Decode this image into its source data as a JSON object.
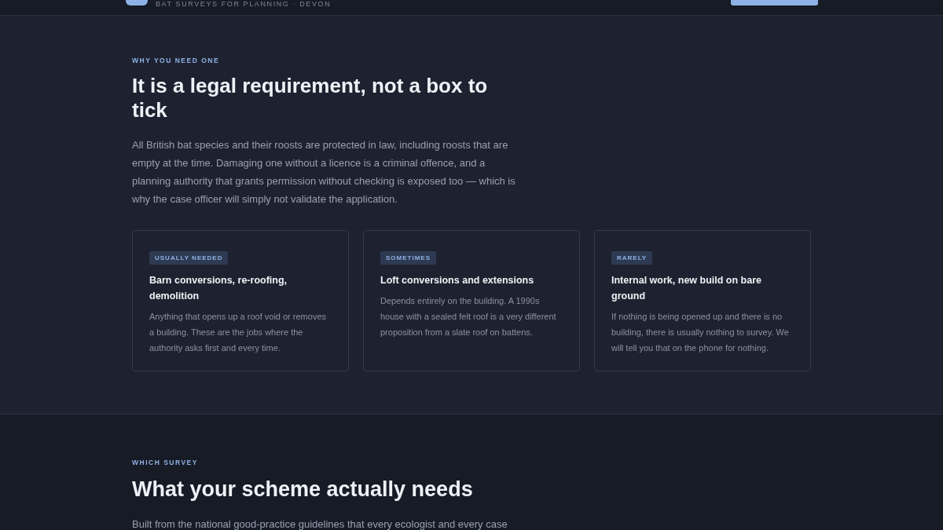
{
  "header": {
    "tagline": "BAT SURVEYS FOR PLANNING · DEVON"
  },
  "sections": [
    {
      "eyebrow": "WHY YOU NEED ONE",
      "heading": "It is a legal requirement, not a box to tick",
      "intro": "All British bat species and their roosts are protected in law, including roosts that are empty at the time. Damaging one without a licence is a criminal offence, and a planning authority that grants permission without checking is exposed too — which is why the case officer will simply not validate the application.",
      "cards": [
        {
          "tag": "USUALLY NEEDED",
          "title": "Barn conversions, re-roofing, demolition",
          "body": "Anything that opens up a roof void or removes a building. These are the jobs where the authority asks first and every time."
        },
        {
          "tag": "SOMETIMES",
          "title": "Loft conversions and extensions",
          "body": "Depends entirely on the building. A 1990s house with a sealed felt roof is a very different proposition from a slate roof on battens."
        },
        {
          "tag": "RARELY",
          "title": "Internal work, new build on bare ground",
          "body": "If nothing is being opened up and there is no building, there is usually nothing to survey. We will tell you that on the phone for nothing."
        }
      ]
    },
    {
      "eyebrow": "WHICH SURVEY",
      "heading": "What your scheme actually needs",
      "intro": "Built from the national good-practice guidelines that every ecologist and every case"
    }
  ]
}
